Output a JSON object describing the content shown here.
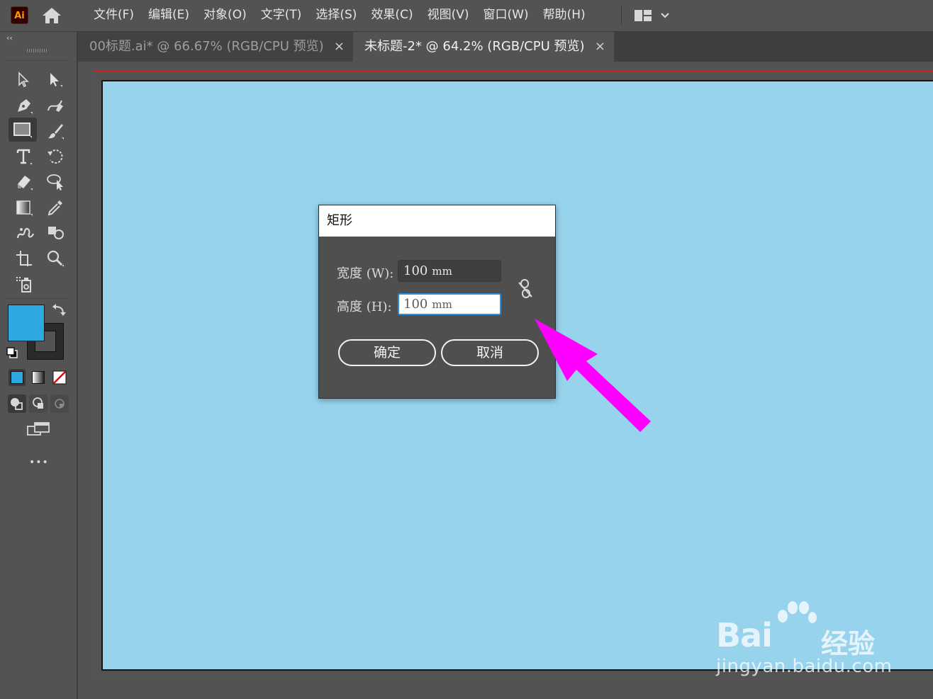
{
  "app": {
    "logo_text": "Ai"
  },
  "menu": {
    "items": [
      "文件(F)",
      "编辑(E)",
      "对象(O)",
      "文字(T)",
      "选择(S)",
      "效果(C)",
      "视图(V)",
      "窗口(W)",
      "帮助(H)"
    ]
  },
  "panel": {
    "collapse_label": "‹‹",
    "more_label": "•••"
  },
  "tabs": [
    {
      "label": "00标题.ai* @ 66.67% (RGB/CPU 预览)",
      "close": "×",
      "active": false
    },
    {
      "label": "未标题-2* @ 64.2% (RGB/CPU 预览)",
      "close": "×",
      "active": true
    }
  ],
  "colors": {
    "fill": "#2fa7df",
    "artboard": "#97d3ed",
    "arrow": "#ff00ff",
    "bleed": "#d02020"
  },
  "dialog": {
    "title": "矩形",
    "width_label": "宽度 (W):",
    "width_value": "100",
    "height_label": "高度 (H):",
    "height_value": "100",
    "unit": "mm",
    "ok_label": "确定",
    "cancel_label": "取消"
  },
  "watermark": {
    "brand": "Bai",
    "brand_tail": "经验",
    "url": "jingyan.baidu.com"
  }
}
